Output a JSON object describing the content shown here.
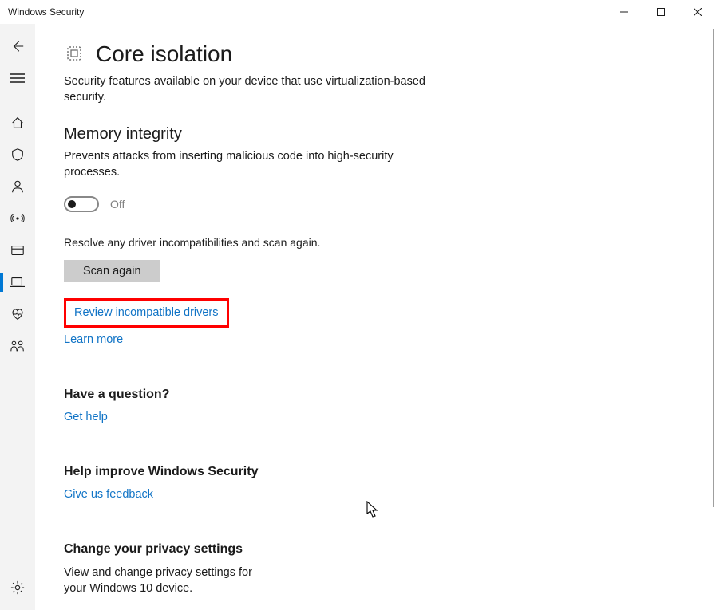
{
  "window": {
    "title": "Windows Security"
  },
  "page": {
    "title": "Core isolation",
    "description": "Security features available on your device that use virtualization-based security."
  },
  "memory_integrity": {
    "title": "Memory integrity",
    "description": "Prevents attacks from inserting malicious code into high-security processes.",
    "toggle_label": "Off",
    "resolve_text": "Resolve any driver incompatibilities and scan again.",
    "scan_button": "Scan again",
    "review_link": "Review incompatible drivers",
    "learn_more": "Learn more"
  },
  "question": {
    "title": "Have a question?",
    "link": "Get help"
  },
  "improve": {
    "title": "Help improve Windows Security",
    "link": "Give us feedback"
  },
  "privacy": {
    "title": "Change your privacy settings",
    "text": "View and change privacy settings for your Windows 10 device."
  }
}
